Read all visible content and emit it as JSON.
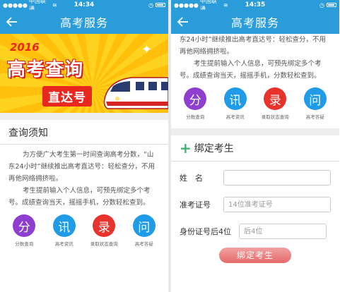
{
  "status_bar": {
    "carrier": "中国联通",
    "time_left": "14:34",
    "time_right": "14:35"
  },
  "header": {
    "title": "高考服务"
  },
  "banner": {
    "year": "2016",
    "title": "高考查询",
    "subtitle": "直达号"
  },
  "notice": {
    "title": "查询须知",
    "para1": "为方便广大考生第一时间查询高考分数，“山东24小时”继续推出高考直达号：轻松查分，不用再他网络拥挤啦。",
    "para1_cont": "东24小时”继续推出高考直达号：轻松查分，不用再他网络拥挤啦。",
    "para2": "考生提前输入个人信息，可预先绑定多个考号。成绩查询当天，摇摇手机，分数轻松查到。"
  },
  "services": [
    {
      "char": "分",
      "label": "分数查询",
      "color": "#8e3fcf",
      "icon": "score-query-icon"
    },
    {
      "char": "讯",
      "label": "高考资讯",
      "color": "#1f9be8",
      "icon": "news-icon"
    },
    {
      "char": "录",
      "label": "录取状态查询",
      "color": "#e8322c",
      "icon": "admission-icon"
    },
    {
      "char": "问",
      "label": "高考答疑",
      "color": "#1f9be8",
      "icon": "qa-icon"
    }
  ],
  "bind_form": {
    "title": "绑定考生",
    "name_label": "姓　名",
    "exam_no_label": "准考证号",
    "exam_no_placeholder": "14位准考证号",
    "id_label": "身份证号后4位",
    "id_placeholder": "后4位",
    "submit_label": "绑定考生"
  }
}
